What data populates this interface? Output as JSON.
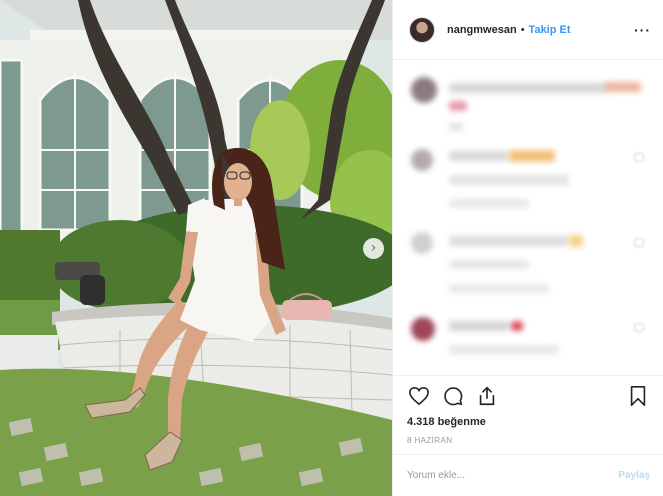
{
  "post": {
    "username": "nangmwesan",
    "separator": "•",
    "follow_label": "Takip Et",
    "more_label": "···",
    "likes": "4.318 beğenme",
    "date": "8 HAZİRAN",
    "comment_placeholder": "Yorum ekle...",
    "share_label": "Paylaş",
    "next_label": "›"
  },
  "icons": [
    "heart-icon",
    "comment-icon",
    "share-icon",
    "bookmark-icon",
    "chevron-right-icon"
  ],
  "colors": {
    "link": "#3897f0",
    "share_disabled": "#b2dffc",
    "muted": "#999999"
  }
}
